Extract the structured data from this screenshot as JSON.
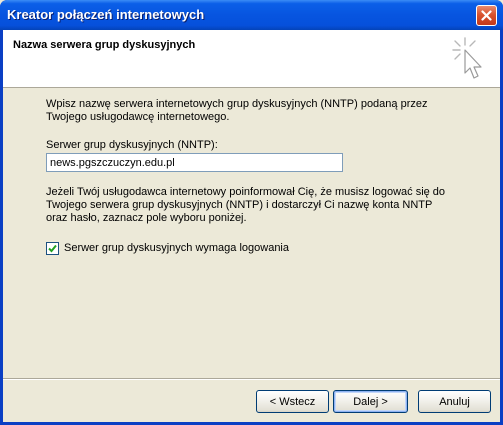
{
  "window": {
    "title": "Kreator połączeń internetowych",
    "close_label": "×"
  },
  "header": {
    "title": "Nazwa serwera grup dyskusyjnych",
    "icon": "wizard-sparkle-cursor-icon"
  },
  "main": {
    "intro_text": "Wpisz nazwę serwera internetowych grup dyskusyjnych (NNTP) podaną przez Twojego usługodawcę internetowego.",
    "server_label": "Serwer grup dyskusyjnych (NNTP):",
    "server_value": "news.pgszczuczyn.edu.pl",
    "login_info_text": "Jeżeli Twój usługodawca internetowy poinformował Cię, że musisz logować się do Twojego serwera grup dyskusyjnych (NNTP) i dostarczył Ci nazwę konta NNTP oraz hasło, zaznacz pole wyboru poniżej.",
    "checkbox_label": "Serwer grup dyskusyjnych wymaga logowania",
    "checkbox_checked": true
  },
  "buttons": {
    "back": "< Wstecz",
    "next": "Dalej >",
    "cancel": "Anuluj"
  },
  "colors": {
    "titlebar": "#0755e0",
    "dialog_bg": "#ece9d8",
    "close_button": "#d9532f",
    "check_mark": "#21a121"
  }
}
